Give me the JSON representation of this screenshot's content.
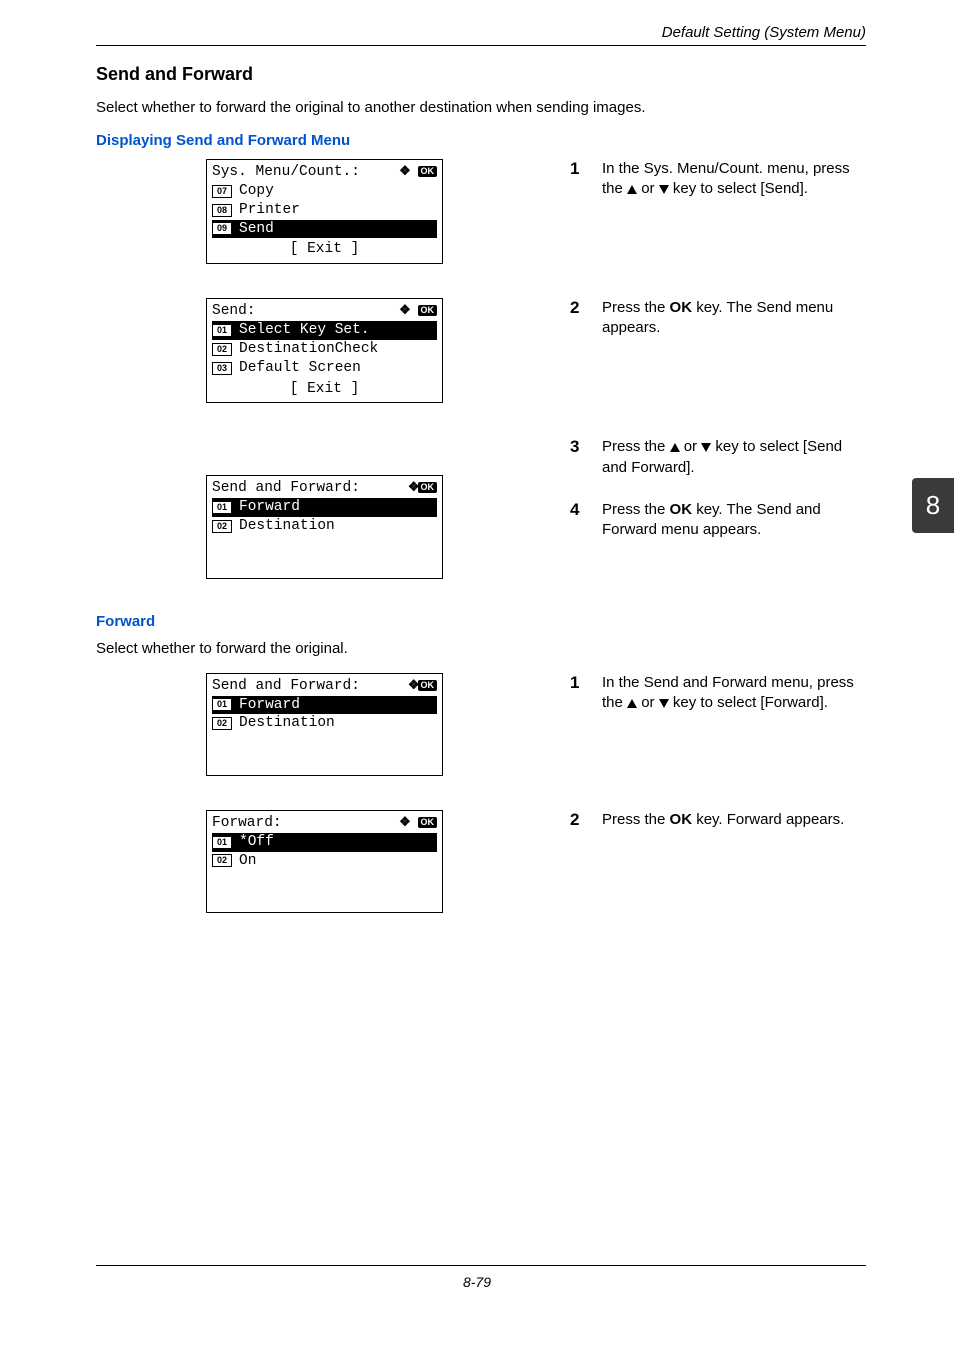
{
  "header": {
    "running": "Default Setting (System Menu)"
  },
  "tab": {
    "num": "8"
  },
  "section": {
    "title": "Send and Forward",
    "intro": "Select whether to forward the original to another destination when sending images."
  },
  "sub1": {
    "title": "Displaying Send and Forward Menu"
  },
  "sub2": {
    "title": "Forward",
    "intro": "Select whether to forward the original."
  },
  "steps_a": {
    "s1": {
      "num": "1",
      "pre": "In the Sys. Menu/Count. menu, press the ",
      "post": " key to select [Send]."
    },
    "s2": {
      "num": "2",
      "pre": "Press the ",
      "b": "OK",
      "post": " key. The Send menu appears."
    },
    "s3": {
      "num": "3",
      "pre": "Press the ",
      "post": " key to select [Send and Forward]."
    },
    "s4": {
      "num": "4",
      "pre": "Press the ",
      "b": "OK",
      "post": " key. The Send and Forward menu appears."
    }
  },
  "steps_b": {
    "s1": {
      "num": "1",
      "pre": "In the Send and Forward menu, press the ",
      "post": " key to select [Forward]."
    },
    "s2": {
      "num": "2",
      "pre": "Press the ",
      "b": "OK",
      "post": " key. Forward appears."
    }
  },
  "lcd1": {
    "title": "Sys. Menu/Count.:",
    "r1": {
      "n": "07",
      "t": "Copy"
    },
    "r2": {
      "n": "08",
      "t": "Printer"
    },
    "r3": {
      "n": "09",
      "t": "Send"
    },
    "exit": "[  Exit   ]"
  },
  "lcd2": {
    "title": "Send:",
    "r1": {
      "n": "01",
      "t": "Select Key Set."
    },
    "r2": {
      "n": "02",
      "t": "DestinationCheck"
    },
    "r3": {
      "n": "03",
      "t": "Default Screen"
    },
    "exit": "[  Exit   ]"
  },
  "lcd3": {
    "title": "Send and Forward:",
    "r1": {
      "n": "01",
      "t": "Forward"
    },
    "r2": {
      "n": "02",
      "t": "Destination"
    }
  },
  "lcd4": {
    "title": "Send and Forward:",
    "r1": {
      "n": "01",
      "t": "Forward"
    },
    "r2": {
      "n": "02",
      "t": "Destination"
    }
  },
  "lcd5": {
    "title": "Forward:",
    "r1": {
      "n": "01",
      "t": "*Off"
    },
    "r2": {
      "n": "02",
      "t": "On"
    }
  },
  "footer": {
    "page": "8-79"
  },
  "glyph": {
    "or": " or ",
    "ok": "OK",
    "nav": "❖"
  }
}
